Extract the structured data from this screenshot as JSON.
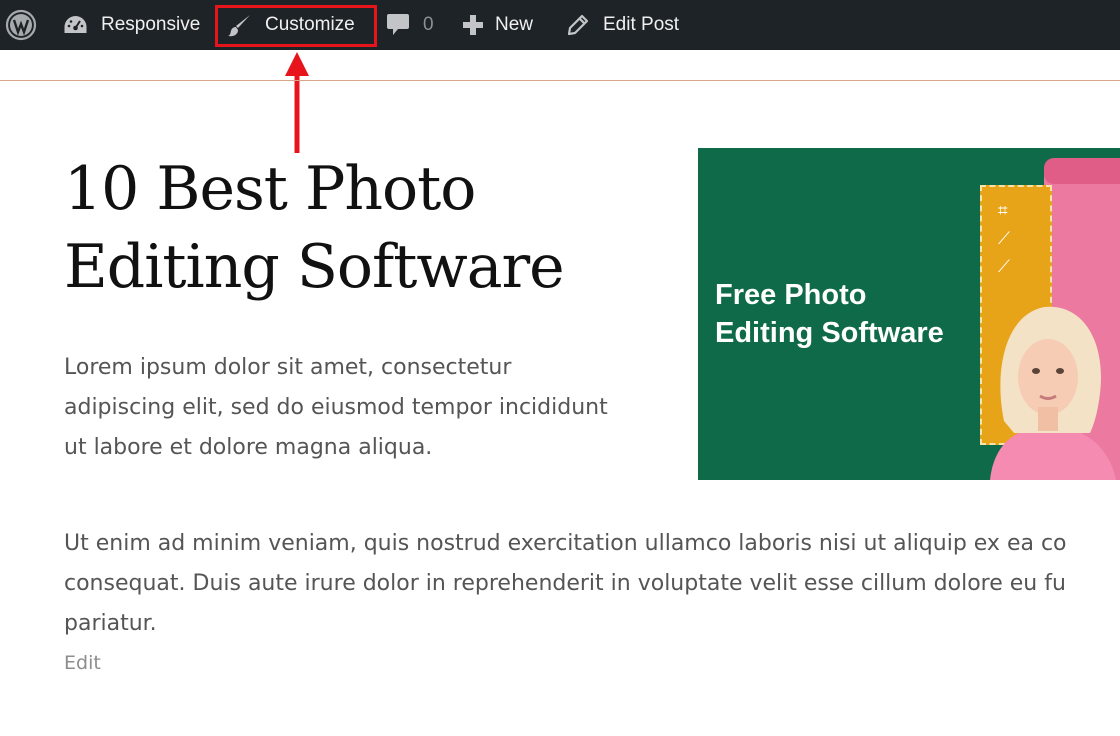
{
  "adminbar": {
    "site_name": "Responsive",
    "customize_label": "Customize",
    "comments_count": "0",
    "new_label": "New",
    "edit_post_label": "Edit Post",
    "icons": [
      "wordpress-icon",
      "dashboard-icon",
      "brush-icon",
      "comment-icon",
      "plus-icon",
      "pencil-icon"
    ]
  },
  "annotation": {
    "color": "#e8141b"
  },
  "post": {
    "title_line1": "10 Best Photo",
    "title_line2": "Editing Software",
    "lead_lines": [
      "Lorem ipsum dolor sit amet, consectetur",
      "adipiscing elit, sed do eiusmod tempor incididunt",
      "ut labore et dolore magna aliqua."
    ],
    "body_lines": [
      "Ut enim ad minim veniam, quis nostrud exercitation ullamco laboris nisi ut aliquip ex ea co",
      "consequat. Duis aute irure dolor in reprehenderit in voluptate velit esse cillum dolore eu fu",
      "pariatur."
    ],
    "edit_link": "Edit"
  },
  "featured_image": {
    "caption_line1": "Free Photo",
    "caption_line2": "Editing Software",
    "background_color": "#0e6a48"
  }
}
